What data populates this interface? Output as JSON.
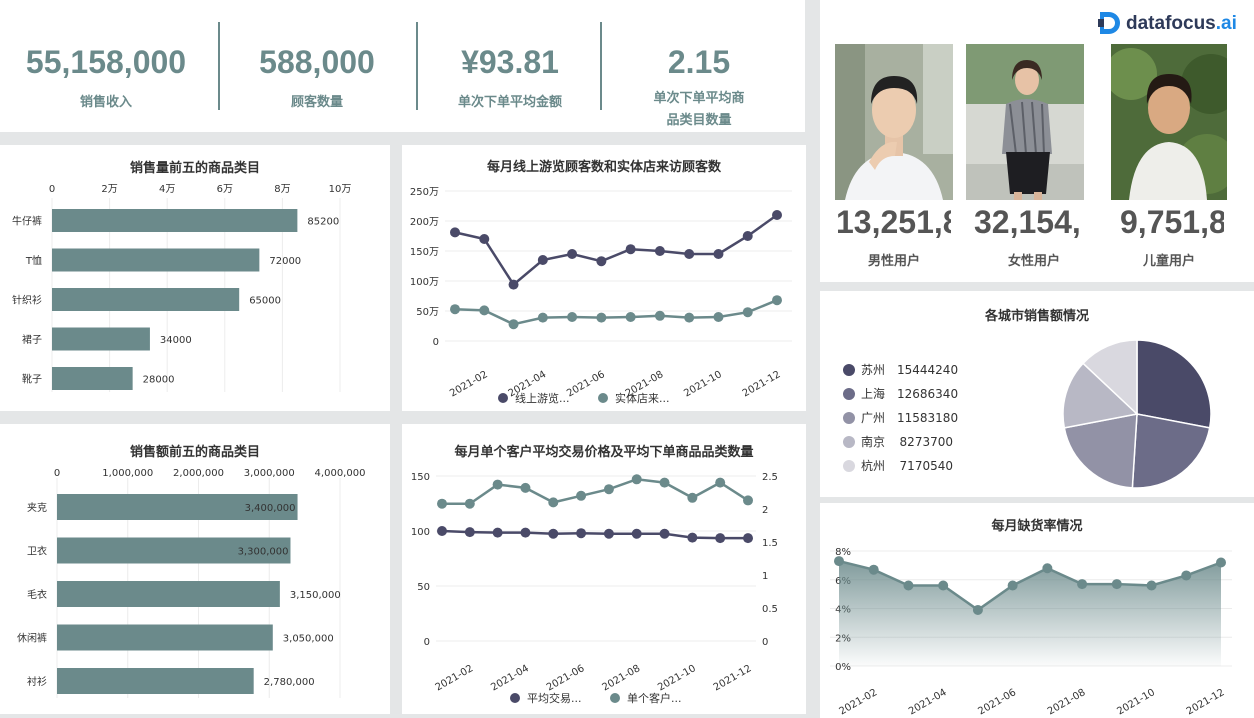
{
  "kpis": [
    {
      "value": "55,158,000",
      "label": "销售收入"
    },
    {
      "value": "588,000",
      "label": "顾客数量"
    },
    {
      "value": "¥93.81",
      "label": "单次下单平均金额"
    },
    {
      "value": "2.15",
      "label": "单次下单平均商",
      "label2": "品类目数量"
    }
  ],
  "brand": {
    "name": "datafocus",
    "suffix": ".ai"
  },
  "users": [
    {
      "value": "13,251,8",
      "label": "男性用户"
    },
    {
      "value": "32,154,",
      "label": "女性用户"
    },
    {
      "value": "9,751,8",
      "label": "儿童用户"
    }
  ],
  "colors": {
    "teal": "#6b8a8b",
    "navy": "#4a4a68",
    "accent": "#1e88e5"
  },
  "charts": {
    "qty_top5": {
      "type": "bar",
      "title": "销售量前五的商品类目",
      "categories": [
        "牛仔裤",
        "T恤",
        "针织衫",
        "裙子",
        "靴子"
      ],
      "values": [
        85200,
        72000,
        65000,
        34000,
        28000
      ],
      "value_labels": [
        "85200",
        "72000",
        "65000",
        "34000",
        "28000"
      ],
      "xlim": [
        0,
        100000
      ],
      "ticks": [
        0,
        20000,
        40000,
        60000,
        80000,
        100000
      ],
      "tick_labels": [
        "0",
        "2万",
        "4万",
        "6万",
        "8万",
        "10万"
      ]
    },
    "amt_top5": {
      "type": "bar",
      "title": "销售额前五的商品类目",
      "categories": [
        "夹克",
        "卫衣",
        "毛衣",
        "休闲裤",
        "衬衫"
      ],
      "values": [
        3400000,
        3300000,
        3150000,
        3050000,
        2780000
      ],
      "value_labels": [
        "3,400,000",
        "3,300,000",
        "3,150,000",
        "3,050,000",
        "2,780,000"
      ],
      "xlim": [
        0,
        4000000
      ],
      "ticks": [
        0,
        1000000,
        2000000,
        3000000,
        4000000
      ],
      "tick_labels": [
        "0",
        "1,000,000",
        "2,000,000",
        "3,000,000",
        "4,000,000"
      ]
    },
    "visitors": {
      "type": "line",
      "title": "每月线上游览顾客数和实体店来访顾客数",
      "x": [
        "2021-01",
        "2021-02",
        "2021-03",
        "2021-04",
        "2021-05",
        "2021-06",
        "2021-07",
        "2021-08",
        "2021-09",
        "2021-10",
        "2021-11",
        "2021-12"
      ],
      "x_tick_labels": [
        "2021-02",
        "2021-04",
        "2021-06",
        "2021-08",
        "2021-10",
        "2021-12"
      ],
      "ylim": [
        0,
        2500000
      ],
      "y_ticks": [
        0,
        500000,
        1000000,
        1500000,
        2000000,
        2500000
      ],
      "y_tick_labels": [
        "0",
        "50万",
        "100万",
        "150万",
        "200万",
        "250万"
      ],
      "series": [
        {
          "name": "线上游览...",
          "values": [
            1810000,
            1700000,
            940000,
            1350000,
            1450000,
            1330000,
            1530000,
            1500000,
            1450000,
            1450000,
            1750000,
            2100000
          ]
        },
        {
          "name": "实体店来...",
          "values": [
            530000,
            510000,
            280000,
            390000,
            400000,
            390000,
            400000,
            420000,
            390000,
            400000,
            480000,
            680000
          ]
        }
      ]
    },
    "avg_price": {
      "type": "line",
      "title": "每月单个客户平均交易价格及平均下单商品品类数量",
      "x": [
        "2021-01",
        "2021-02",
        "2021-03",
        "2021-04",
        "2021-05",
        "2021-06",
        "2021-07",
        "2021-08",
        "2021-09",
        "2021-10",
        "2021-11",
        "2021-12"
      ],
      "x_tick_labels": [
        "2021-02",
        "2021-04",
        "2021-06",
        "2021-08",
        "2021-10",
        "2021-12"
      ],
      "ylim": [
        0,
        150
      ],
      "y_ticks": [
        0,
        50,
        100,
        150
      ],
      "y_tick_labels": [
        "0",
        "50",
        "100",
        "150"
      ],
      "y2lim": [
        0,
        2.5
      ],
      "y2_ticks": [
        0,
        0.5,
        1,
        1.5,
        2,
        2.5
      ],
      "y2_tick_labels": [
        "0",
        "0.5",
        "1",
        "1.5",
        "2",
        "2.5"
      ],
      "series": [
        {
          "name": "平均交易...",
          "axis": "left",
          "values": [
            100,
            99,
            98.5,
            98.5,
            97.5,
            98,
            97.5,
            97.5,
            97.5,
            94,
            93.5,
            93.5
          ]
        },
        {
          "name": "单个客户...",
          "axis": "right",
          "values": [
            2.08,
            2.08,
            2.37,
            2.32,
            2.1,
            2.2,
            2.3,
            2.45,
            2.4,
            2.17,
            2.4,
            2.13
          ]
        }
      ]
    },
    "city_sales": {
      "type": "pie",
      "title": "各城市销售额情况",
      "labels": [
        "苏州",
        "上海",
        "广州",
        "南京",
        "杭州"
      ],
      "values": [
        15444240,
        12686340,
        11583180,
        8273700,
        7170540
      ],
      "value_labels": [
        "15444240",
        "12686340",
        "11583180",
        "8273700",
        "7170540"
      ],
      "colors": [
        "#4a4a68",
        "#6c6c88",
        "#9292a6",
        "#b8b8c5",
        "#d9d8df"
      ]
    },
    "stockout": {
      "type": "area",
      "title": "每月缺货率情况",
      "x": [
        "2021-01",
        "2021-02",
        "2021-03",
        "2021-04",
        "2021-05",
        "2021-06",
        "2021-07",
        "2021-08",
        "2021-09",
        "2021-10",
        "2021-11",
        "2021-12"
      ],
      "x_tick_labels": [
        "2021-02",
        "2021-04",
        "2021-06",
        "2021-08",
        "2021-10",
        "2021-12"
      ],
      "ylim": [
        0,
        0.08
      ],
      "y_ticks": [
        0,
        0.02,
        0.04,
        0.06,
        0.08
      ],
      "y_tick_labels": [
        "0%",
        "2%",
        "4%",
        "6%",
        "8%"
      ],
      "values": [
        0.073,
        0.067,
        0.056,
        0.056,
        0.039,
        0.056,
        0.068,
        0.057,
        0.057,
        0.056,
        0.063,
        0.072
      ]
    }
  }
}
